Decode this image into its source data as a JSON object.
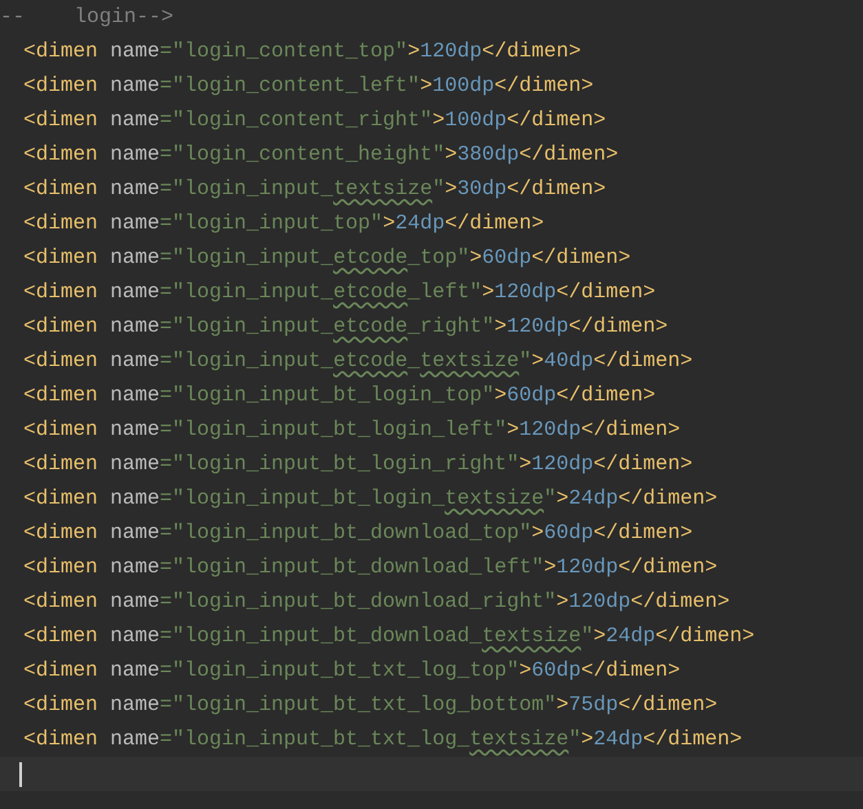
{
  "lines": [
    {
      "kind": "comment",
      "text": "--    login-->"
    },
    {
      "kind": "code",
      "segments": [
        {
          "kind": "tag",
          "text": "<dimen",
          "flagged": false
        },
        {
          "kind": "attr",
          "text": " name",
          "flagged": false
        },
        {
          "kind": "string",
          "text": "=\"login_content_top\"",
          "flagged": false
        },
        {
          "kind": "tag",
          "text": ">",
          "flagged": false
        },
        {
          "kind": "number",
          "text": "120dp",
          "flagged": false
        },
        {
          "kind": "tag",
          "text": "</dimen>",
          "flagged": false
        }
      ]
    },
    {
      "kind": "code",
      "segments": [
        {
          "kind": "tag",
          "text": "<dimen",
          "flagged": false
        },
        {
          "kind": "attr",
          "text": " name",
          "flagged": false
        },
        {
          "kind": "string",
          "text": "=\"login_content_left\"",
          "flagged": false
        },
        {
          "kind": "tag",
          "text": ">",
          "flagged": false
        },
        {
          "kind": "number",
          "text": "100dp",
          "flagged": false
        },
        {
          "kind": "tag",
          "text": "</dimen>",
          "flagged": false
        }
      ]
    },
    {
      "kind": "code",
      "segments": [
        {
          "kind": "tag",
          "text": "<dimen",
          "flagged": false
        },
        {
          "kind": "attr",
          "text": " name",
          "flagged": false
        },
        {
          "kind": "string",
          "text": "=\"login_content_right\"",
          "flagged": false
        },
        {
          "kind": "tag",
          "text": ">",
          "flagged": false
        },
        {
          "kind": "number",
          "text": "100dp",
          "flagged": false
        },
        {
          "kind": "tag",
          "text": "</dimen>",
          "flagged": false
        }
      ]
    },
    {
      "kind": "code",
      "segments": [
        {
          "kind": "tag",
          "text": "<dimen",
          "flagged": false
        },
        {
          "kind": "attr",
          "text": " name",
          "flagged": false
        },
        {
          "kind": "string",
          "text": "=\"login_content_height\"",
          "flagged": false
        },
        {
          "kind": "tag",
          "text": ">",
          "flagged": false
        },
        {
          "kind": "number",
          "text": "380dp",
          "flagged": false
        },
        {
          "kind": "tag",
          "text": "</dimen>",
          "flagged": false
        }
      ]
    },
    {
      "kind": "code",
      "segments": [
        {
          "kind": "tag",
          "text": "<dimen",
          "flagged": false
        },
        {
          "kind": "attr",
          "text": " name",
          "flagged": false
        },
        {
          "kind": "string",
          "text": "=\"login_input_",
          "flagged": false
        },
        {
          "kind": "string",
          "text": "textsize",
          "flagged": true
        },
        {
          "kind": "string",
          "text": "\"",
          "flagged": false
        },
        {
          "kind": "tag",
          "text": ">",
          "flagged": false
        },
        {
          "kind": "number",
          "text": "30dp",
          "flagged": false
        },
        {
          "kind": "tag",
          "text": "</dimen>",
          "flagged": false
        }
      ]
    },
    {
      "kind": "code",
      "segments": [
        {
          "kind": "tag",
          "text": "<dimen",
          "flagged": false
        },
        {
          "kind": "attr",
          "text": " name",
          "flagged": false
        },
        {
          "kind": "string",
          "text": "=\"login_input_top\"",
          "flagged": false
        },
        {
          "kind": "tag",
          "text": ">",
          "flagged": false
        },
        {
          "kind": "number",
          "text": "24dp",
          "flagged": false
        },
        {
          "kind": "tag",
          "text": "</dimen>",
          "flagged": false
        }
      ]
    },
    {
      "kind": "code",
      "segments": [
        {
          "kind": "tag",
          "text": "<dimen",
          "flagged": false
        },
        {
          "kind": "attr",
          "text": " name",
          "flagged": false
        },
        {
          "kind": "string",
          "text": "=\"login_input_",
          "flagged": false
        },
        {
          "kind": "string",
          "text": "etcode",
          "flagged": true
        },
        {
          "kind": "string",
          "text": "_top\"",
          "flagged": false
        },
        {
          "kind": "tag",
          "text": ">",
          "flagged": false
        },
        {
          "kind": "number",
          "text": "60dp",
          "flagged": false
        },
        {
          "kind": "tag",
          "text": "</dimen>",
          "flagged": false
        }
      ]
    },
    {
      "kind": "code",
      "segments": [
        {
          "kind": "tag",
          "text": "<dimen",
          "flagged": false
        },
        {
          "kind": "attr",
          "text": " name",
          "flagged": false
        },
        {
          "kind": "string",
          "text": "=\"login_input_",
          "flagged": false
        },
        {
          "kind": "string",
          "text": "etcode",
          "flagged": true
        },
        {
          "kind": "string",
          "text": "_left\"",
          "flagged": false
        },
        {
          "kind": "tag",
          "text": ">",
          "flagged": false
        },
        {
          "kind": "number",
          "text": "120dp",
          "flagged": false
        },
        {
          "kind": "tag",
          "text": "</dimen>",
          "flagged": false
        }
      ]
    },
    {
      "kind": "code",
      "segments": [
        {
          "kind": "tag",
          "text": "<dimen",
          "flagged": false
        },
        {
          "kind": "attr",
          "text": " name",
          "flagged": false
        },
        {
          "kind": "string",
          "text": "=\"login_input_",
          "flagged": false
        },
        {
          "kind": "string",
          "text": "etcode",
          "flagged": true
        },
        {
          "kind": "string",
          "text": "_right\"",
          "flagged": false
        },
        {
          "kind": "tag",
          "text": ">",
          "flagged": false
        },
        {
          "kind": "number",
          "text": "120dp",
          "flagged": false
        },
        {
          "kind": "tag",
          "text": "</dimen>",
          "flagged": false
        }
      ]
    },
    {
      "kind": "code",
      "segments": [
        {
          "kind": "tag",
          "text": "<dimen",
          "flagged": false
        },
        {
          "kind": "attr",
          "text": " name",
          "flagged": false
        },
        {
          "kind": "string",
          "text": "=\"login_input_",
          "flagged": false
        },
        {
          "kind": "string",
          "text": "etcode",
          "flagged": true
        },
        {
          "kind": "string",
          "text": "_",
          "flagged": false
        },
        {
          "kind": "string",
          "text": "textsize",
          "flagged": true
        },
        {
          "kind": "string",
          "text": "\"",
          "flagged": false
        },
        {
          "kind": "tag",
          "text": ">",
          "flagged": false
        },
        {
          "kind": "number",
          "text": "40dp",
          "flagged": false
        },
        {
          "kind": "tag",
          "text": "</dimen>",
          "flagged": false
        }
      ]
    },
    {
      "kind": "code",
      "segments": [
        {
          "kind": "tag",
          "text": "<dimen",
          "flagged": false
        },
        {
          "kind": "attr",
          "text": " name",
          "flagged": false
        },
        {
          "kind": "string",
          "text": "=\"login_input_bt_login_top\"",
          "flagged": false
        },
        {
          "kind": "tag",
          "text": ">",
          "flagged": false
        },
        {
          "kind": "number",
          "text": "60dp",
          "flagged": false
        },
        {
          "kind": "tag",
          "text": "</dimen>",
          "flagged": false
        }
      ]
    },
    {
      "kind": "code",
      "segments": [
        {
          "kind": "tag",
          "text": "<dimen",
          "flagged": false
        },
        {
          "kind": "attr",
          "text": " name",
          "flagged": false
        },
        {
          "kind": "string",
          "text": "=\"login_input_bt_login_left\"",
          "flagged": false
        },
        {
          "kind": "tag",
          "text": ">",
          "flagged": false
        },
        {
          "kind": "number",
          "text": "120dp",
          "flagged": false
        },
        {
          "kind": "tag",
          "text": "</dimen>",
          "flagged": false
        }
      ]
    },
    {
      "kind": "code",
      "segments": [
        {
          "kind": "tag",
          "text": "<dimen",
          "flagged": false
        },
        {
          "kind": "attr",
          "text": " name",
          "flagged": false
        },
        {
          "kind": "string",
          "text": "=\"login_input_bt_login_right\"",
          "flagged": false
        },
        {
          "kind": "tag",
          "text": ">",
          "flagged": false
        },
        {
          "kind": "number",
          "text": "120dp",
          "flagged": false
        },
        {
          "kind": "tag",
          "text": "</dimen>",
          "flagged": false
        }
      ]
    },
    {
      "kind": "code",
      "segments": [
        {
          "kind": "tag",
          "text": "<dimen",
          "flagged": false
        },
        {
          "kind": "attr",
          "text": " name",
          "flagged": false
        },
        {
          "kind": "string",
          "text": "=\"login_input_bt_login_",
          "flagged": false
        },
        {
          "kind": "string",
          "text": "textsize",
          "flagged": true
        },
        {
          "kind": "string",
          "text": "\"",
          "flagged": false
        },
        {
          "kind": "tag",
          "text": ">",
          "flagged": false
        },
        {
          "kind": "number",
          "text": "24dp",
          "flagged": false
        },
        {
          "kind": "tag",
          "text": "</dimen>",
          "flagged": false
        }
      ]
    },
    {
      "kind": "code",
      "segments": [
        {
          "kind": "tag",
          "text": "<dimen",
          "flagged": false
        },
        {
          "kind": "attr",
          "text": " name",
          "flagged": false
        },
        {
          "kind": "string",
          "text": "=\"login_input_bt_download_top\"",
          "flagged": false
        },
        {
          "kind": "tag",
          "text": ">",
          "flagged": false
        },
        {
          "kind": "number",
          "text": "60dp",
          "flagged": false
        },
        {
          "kind": "tag",
          "text": "</dimen>",
          "flagged": false
        }
      ]
    },
    {
      "kind": "code",
      "segments": [
        {
          "kind": "tag",
          "text": "<dimen",
          "flagged": false
        },
        {
          "kind": "attr",
          "text": " name",
          "flagged": false
        },
        {
          "kind": "string",
          "text": "=\"login_input_bt_download_left\"",
          "flagged": false
        },
        {
          "kind": "tag",
          "text": ">",
          "flagged": false
        },
        {
          "kind": "number",
          "text": "120dp",
          "flagged": false
        },
        {
          "kind": "tag",
          "text": "</dimen>",
          "flagged": false
        }
      ]
    },
    {
      "kind": "code",
      "segments": [
        {
          "kind": "tag",
          "text": "<dimen",
          "flagged": false
        },
        {
          "kind": "attr",
          "text": " name",
          "flagged": false
        },
        {
          "kind": "string",
          "text": "=\"login_input_bt_download_right\"",
          "flagged": false
        },
        {
          "kind": "tag",
          "text": ">",
          "flagged": false
        },
        {
          "kind": "number",
          "text": "120dp",
          "flagged": false
        },
        {
          "kind": "tag",
          "text": "</dimen>",
          "flagged": false
        }
      ]
    },
    {
      "kind": "code",
      "segments": [
        {
          "kind": "tag",
          "text": "<dimen",
          "flagged": false
        },
        {
          "kind": "attr",
          "text": " name",
          "flagged": false
        },
        {
          "kind": "string",
          "text": "=\"login_input_bt_download_",
          "flagged": false
        },
        {
          "kind": "string",
          "text": "textsize",
          "flagged": true
        },
        {
          "kind": "string",
          "text": "\"",
          "flagged": false
        },
        {
          "kind": "tag",
          "text": ">",
          "flagged": false
        },
        {
          "kind": "number",
          "text": "24dp",
          "flagged": false
        },
        {
          "kind": "tag",
          "text": "</dimen>",
          "flagged": false
        }
      ]
    },
    {
      "kind": "code",
      "segments": [
        {
          "kind": "tag",
          "text": "<dimen",
          "flagged": false
        },
        {
          "kind": "attr",
          "text": " name",
          "flagged": false
        },
        {
          "kind": "string",
          "text": "=\"login_input_bt_txt_log_top\"",
          "flagged": false
        },
        {
          "kind": "tag",
          "text": ">",
          "flagged": false
        },
        {
          "kind": "number",
          "text": "60dp",
          "flagged": false
        },
        {
          "kind": "tag",
          "text": "</dimen>",
          "flagged": false
        }
      ]
    },
    {
      "kind": "code",
      "segments": [
        {
          "kind": "tag",
          "text": "<dimen",
          "flagged": false
        },
        {
          "kind": "attr",
          "text": " name",
          "flagged": false
        },
        {
          "kind": "string",
          "text": "=\"login_input_bt_txt_log_bottom\"",
          "flagged": false
        },
        {
          "kind": "tag",
          "text": ">",
          "flagged": false
        },
        {
          "kind": "number",
          "text": "75dp",
          "flagged": false
        },
        {
          "kind": "tag",
          "text": "</dimen>",
          "flagged": false
        }
      ]
    },
    {
      "kind": "code",
      "segments": [
        {
          "kind": "tag",
          "text": "<dimen",
          "flagged": false
        },
        {
          "kind": "attr",
          "text": " name",
          "flagged": false
        },
        {
          "kind": "string",
          "text": "=\"login_input_bt_txt_log_",
          "flagged": false
        },
        {
          "kind": "string",
          "text": "textsize",
          "flagged": true
        },
        {
          "kind": "string",
          "text": "\"",
          "flagged": false
        },
        {
          "kind": "tag",
          "text": ">",
          "flagged": false
        },
        {
          "kind": "number",
          "text": "24dp",
          "flagged": false
        },
        {
          "kind": "tag",
          "text": "</dimen>",
          "flagged": false
        }
      ]
    },
    {
      "kind": "caret"
    }
  ]
}
